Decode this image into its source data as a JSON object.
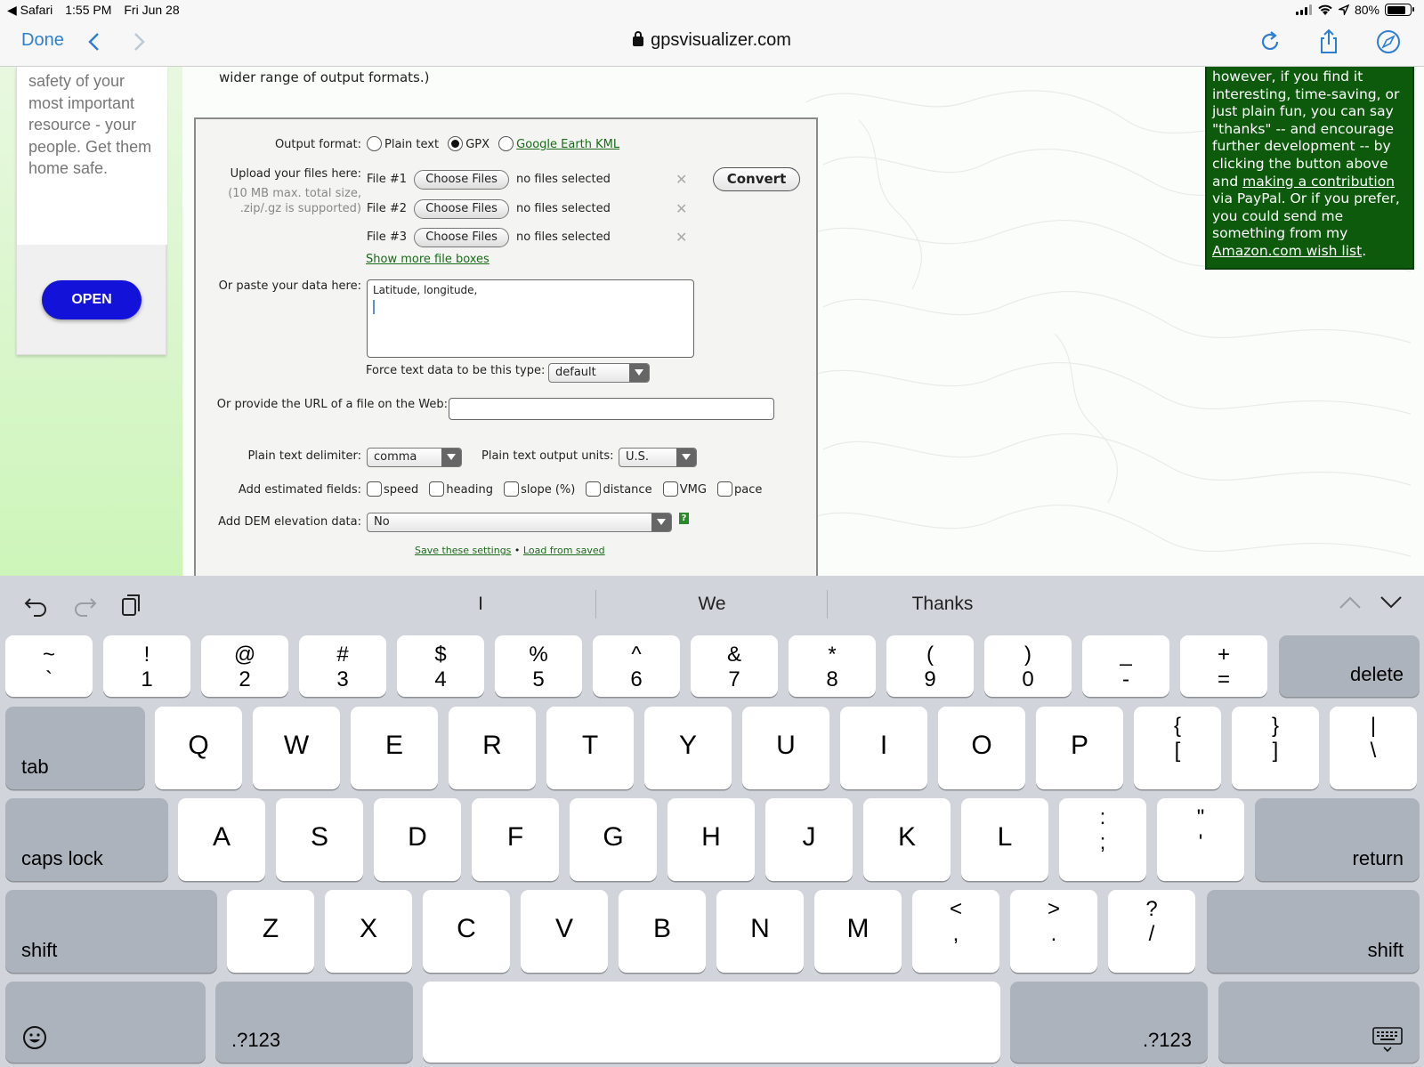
{
  "status": {
    "back_app": "◀ Safari",
    "time": "1:55 PM",
    "date": "Fri Jun 28",
    "battery": "80%",
    "battery_level": 0.8
  },
  "browser": {
    "done_label": "Done",
    "back_icon": "chevron-left-icon",
    "forward_icon": "chevron-right-icon",
    "url": "gpsvisualizer.com",
    "reload_icon": "reload-icon",
    "share_icon": "share-icon",
    "compass_icon": "compass-icon"
  },
  "ad": {
    "text": "safety of your most important resource - your people. Get them home safe.",
    "open_label": "OPEN",
    "button_color": "#1212d9"
  },
  "page": {
    "intro_text": "wider range of output formats.)",
    "output_format_label": "Output format:",
    "formats": [
      "Plain text",
      "GPX",
      "Google Earth KML"
    ],
    "selected_format": "GPX",
    "upload_label": "Upload your files here:",
    "upload_hint_1": "(10 MB max. total size,",
    "upload_hint_2": ".zip/.gz is supported)",
    "files": [
      {
        "label": "File #1",
        "button": "Choose Files",
        "status": "no files selected"
      },
      {
        "label": "File #2",
        "button": "Choose Files",
        "status": "no files selected"
      },
      {
        "label": "File #3",
        "button": "Choose Files",
        "status": "no files selected"
      }
    ],
    "remove_glyph": "✕",
    "convert_label": "Convert",
    "show_more": "Show more file boxes",
    "paste_label": "Or paste your data here:",
    "paste_value": "Latitude, longitude,",
    "force_type_label": "Force text data to be this type:",
    "force_type_value": "default",
    "url_label": "Or provide the URL of a file on the Web:",
    "url_value": "",
    "delimiter_label": "Plain text delimiter:",
    "delimiter_value": "comma",
    "units_label": "Plain text output units:",
    "units_value": "U.S.",
    "estimated_label": "Add estimated fields:",
    "estimated_fields": [
      "speed",
      "heading",
      "slope (%)",
      "distance",
      "VMG",
      "pace"
    ],
    "dem_label": "Add DEM elevation data:",
    "dem_value": "No",
    "help_glyph": "?",
    "save_link": "Save these settings",
    "bullet": "•",
    "load_link": "Load from saved",
    "link_color": "#1a6b1a"
  },
  "donate": {
    "text_1": "however, if you find it interesting, time-saving, or just plain fun, you can say \"thanks\" -- and encourage further development -- by clicking the button above and ",
    "link_1": "making a contribution",
    "text_2": " via PayPal. Or if you prefer, you could send me something from my ",
    "link_2": "Amazon.com wish list",
    "text_3": ".",
    "bg_color": "#0d5a0d"
  },
  "keyboard": {
    "suggestions": [
      "I",
      "We",
      "Thanks"
    ],
    "number_row": [
      {
        "top": "~",
        "bottom": "`"
      },
      {
        "top": "!",
        "bottom": "1"
      },
      {
        "top": "@",
        "bottom": "2"
      },
      {
        "top": "#",
        "bottom": "3"
      },
      {
        "top": "$",
        "bottom": "4"
      },
      {
        "top": "%",
        "bottom": "5"
      },
      {
        "top": "^",
        "bottom": "6"
      },
      {
        "top": "&",
        "bottom": "7"
      },
      {
        "top": "*",
        "bottom": "8"
      },
      {
        "top": "(",
        "bottom": "9"
      },
      {
        "top": ")",
        "bottom": "0"
      },
      {
        "top": "_",
        "bottom": "-"
      },
      {
        "top": "+",
        "bottom": "="
      }
    ],
    "delete_label": "delete",
    "tab_label": "tab",
    "row_q": [
      "Q",
      "W",
      "E",
      "R",
      "T",
      "Y",
      "U",
      "I",
      "O",
      "P"
    ],
    "row_q_sym": [
      {
        "top": "{",
        "bottom": "["
      },
      {
        "top": "}",
        "bottom": "]"
      },
      {
        "top": "|",
        "bottom": "\\"
      }
    ],
    "caps_label": "caps lock",
    "row_a": [
      "A",
      "S",
      "D",
      "F",
      "G",
      "H",
      "J",
      "K",
      "L"
    ],
    "row_a_sym": [
      {
        "top": ":",
        "bottom": ";"
      },
      {
        "top": "\"",
        "bottom": "'"
      }
    ],
    "return_label": "return",
    "shift_label": "shift",
    "row_z": [
      "Z",
      "X",
      "C",
      "V",
      "B",
      "N",
      "M"
    ],
    "row_z_sym": [
      {
        "top": "<",
        "bottom": ","
      },
      {
        "top": ">",
        "bottom": "."
      },
      {
        "top": "?",
        "bottom": "/"
      }
    ],
    "numbers_label": ".?123",
    "emoji_icon": "emoji-icon",
    "dismiss_icon": "keyboard-dismiss-icon"
  }
}
